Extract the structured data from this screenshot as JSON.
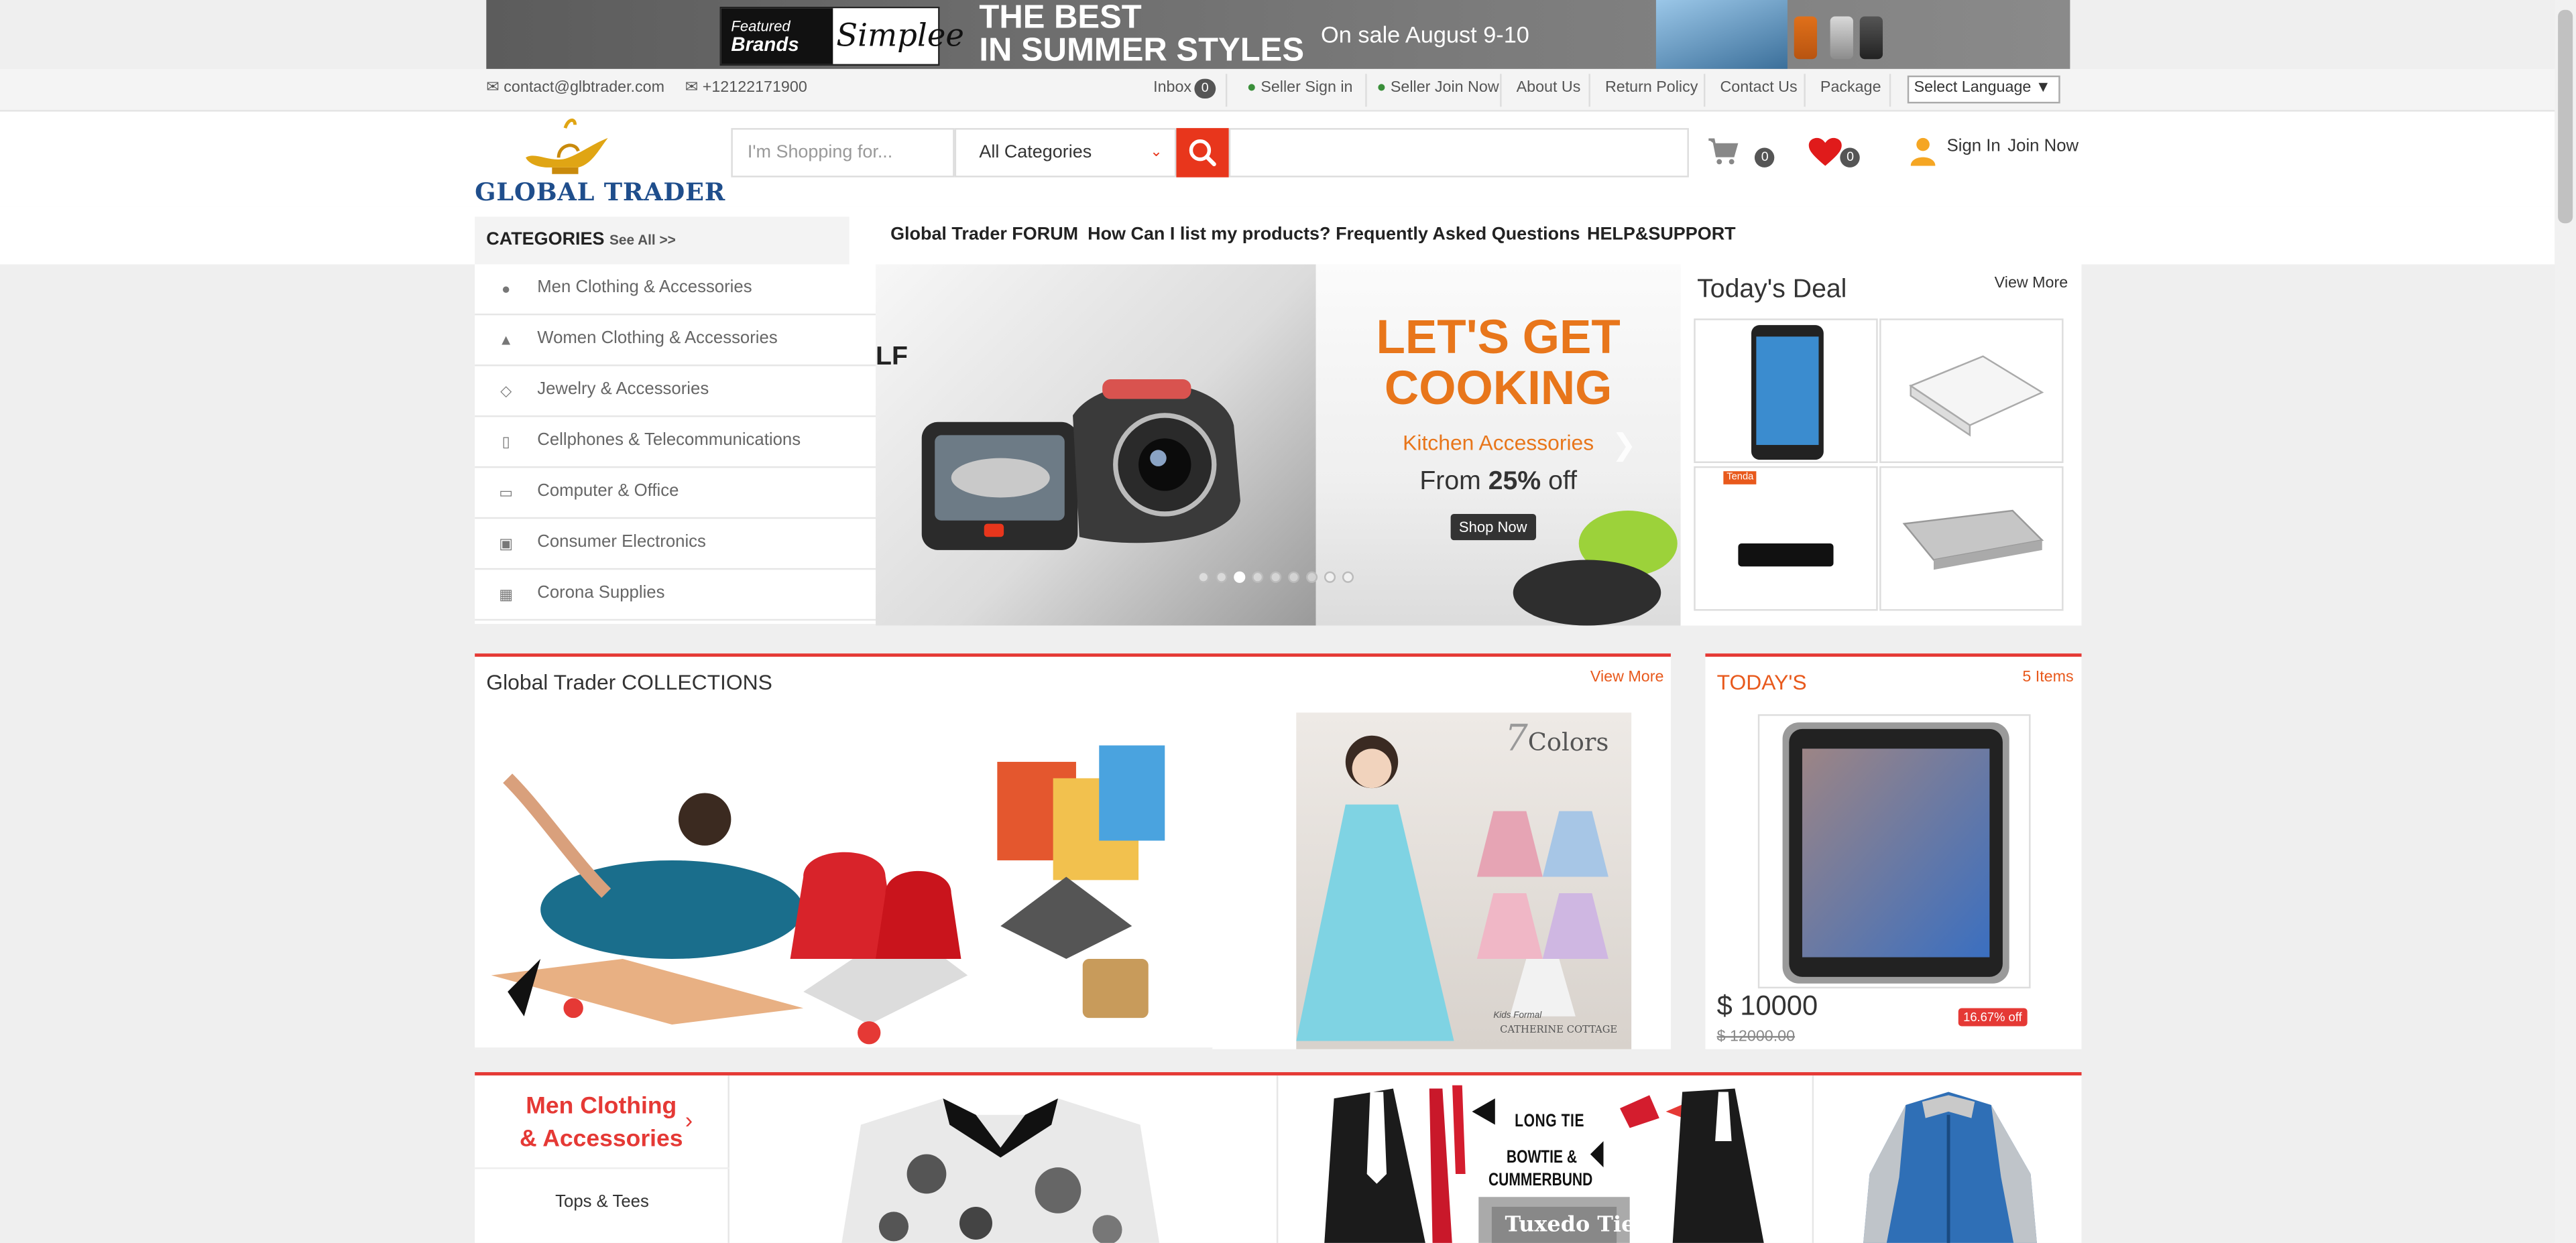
{
  "banner": {
    "featured": "Featured",
    "brands": "Brands",
    "brand_name": "Simplee",
    "line1": "THE BEST",
    "line2": "IN SUMMER STYLES",
    "sale": "On sale August 9-10"
  },
  "utility": {
    "email": "contact@glbtrader.com",
    "phone": "+12122171900",
    "inbox_label": "Inbox",
    "inbox_count": "0",
    "links": [
      "Seller Sign in",
      "Seller Join Now",
      "About Us",
      "Return Policy",
      "Contact Us",
      "Package"
    ],
    "language": "Select Language"
  },
  "header": {
    "logo_text": "GLOBAL TRADER",
    "search_placeholder": "I'm Shopping for...",
    "category_select": "All Categories",
    "cart_count": "0",
    "wishlist_count": "0",
    "sign_in": "Sign In",
    "join_now": "Join Now"
  },
  "nav": {
    "categories_title": "CATEGORIES",
    "see_all": "See All >>",
    "links": [
      "Global Trader FORUM",
      "How Can I list my products?",
      "Frequently Asked Questions",
      "HELP&SUPPORT"
    ]
  },
  "categories": [
    {
      "label": "Men Clothing & Accessories",
      "icon": "person-icon"
    },
    {
      "label": "Women Clothing & Accessories",
      "icon": "female-icon"
    },
    {
      "label": "Jewelry & Accessories",
      "icon": "diamond-icon"
    },
    {
      "label": "Cellphones & Telecommunications",
      "icon": "mobile-icon"
    },
    {
      "label": "Computer & Office",
      "icon": "desktop-icon"
    },
    {
      "label": "Consumer Electronics",
      "icon": "camera-icon"
    },
    {
      "label": "Corona Supplies",
      "icon": "truck-icon"
    }
  ],
  "slider": {
    "left_text": "LF",
    "heading1": "LET'S GET",
    "heading2": "COOKING",
    "sub": "Kitchen Accessories",
    "from": "From",
    "pct": "25%",
    "off": "off",
    "button": "Shop Now",
    "active_slide": 3,
    "slide_count": 9
  },
  "deal": {
    "title": "Today's Deal",
    "view_more": "View More",
    "tag": "Tenda"
  },
  "collections": {
    "title": "Global Trader COLLECTIONS",
    "view_more": "View More",
    "colors_num": "7",
    "colors_word": "Colors",
    "caption1": "Kids Formal",
    "caption2": "CATHERINE COTTAGE"
  },
  "todays": {
    "title": "TODAY'S",
    "items": "5 Items",
    "price": "$ 10000",
    "old_price": "$ 12000.00",
    "discount": "16.67% off"
  },
  "men_section": {
    "title_line1": "Men Clothing",
    "title_line2": "& Accessories",
    "sub": "Tops & Tees",
    "tie1": "LONG TIE",
    "tie2": "BOWTIE &",
    "tie3": "CUMMERBUND",
    "tie4": "Tuxedo Tie"
  },
  "colors": {
    "accent": "#e53935",
    "orange": "#e8761b",
    "search_button": "#e8361c",
    "logo_blue": "#1f4e8c"
  }
}
